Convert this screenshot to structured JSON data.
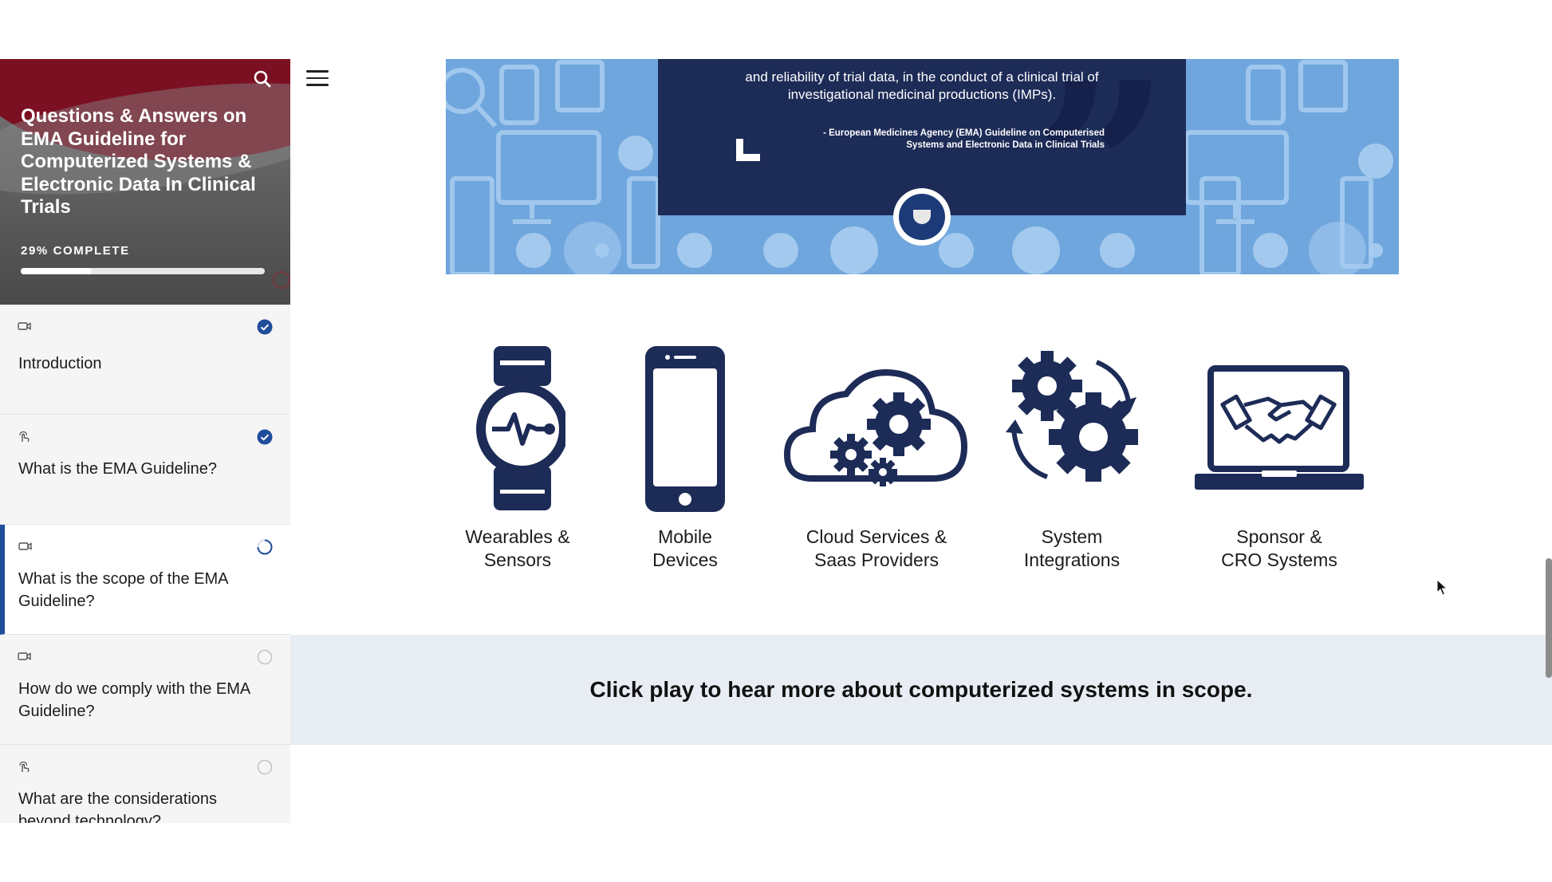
{
  "sidebar": {
    "title": "Questions & Answers on EMA Guideline for Computerized Systems & Electronic Data In Clinical Trials",
    "progress_label": "29% COMPLETE",
    "progress_fraction": 0.29,
    "lessons": [
      {
        "type_icon": "video-icon",
        "status": "complete",
        "title": "Introduction"
      },
      {
        "type_icon": "interactive-icon",
        "status": "complete",
        "title": "What is the EMA Guideline?"
      },
      {
        "type_icon": "video-icon",
        "status": "in-progress",
        "title": "What is the scope of the EMA Guideline?"
      },
      {
        "type_icon": "video-icon",
        "status": "not-started",
        "title": "How do we comply with the EMA Guideline?"
      },
      {
        "type_icon": "interactive-icon",
        "status": "not-started",
        "title": "What are the considerations beyond technology?"
      }
    ]
  },
  "banner": {
    "quote_partial": "and reliability of trial data, in the conduct of a clinical trial of investigational medicinal productions (IMPs).",
    "quote_source": "- European Medicines Agency (EMA) Guideline on Computerised Systems and Electronic Data in Clinical Trials"
  },
  "systems": [
    {
      "icon": "smartwatch-icon",
      "label_line1": "Wearables &",
      "label_line2": "Sensors"
    },
    {
      "icon": "smartphone-icon",
      "label_line1": "Mobile",
      "label_line2": "Devices"
    },
    {
      "icon": "cloud-gears-icon",
      "label_line1": "Cloud Services &",
      "label_line2": "Saas Providers"
    },
    {
      "icon": "gears-cycle-icon",
      "label_line1": "System",
      "label_line2": "Integrations"
    },
    {
      "icon": "laptop-handshake-icon",
      "label_line1": "Sponsor &",
      "label_line2": "CRO Systems"
    }
  ],
  "cta": {
    "text": "Click play to hear more about computerized systems in scope."
  },
  "colors": {
    "accent_blue": "#1f4d9c",
    "navy": "#1d2b57",
    "banner_blue": "#6fa6dd",
    "brand_red": "#7b1022",
    "cta_band": "#e8ecf3"
  }
}
